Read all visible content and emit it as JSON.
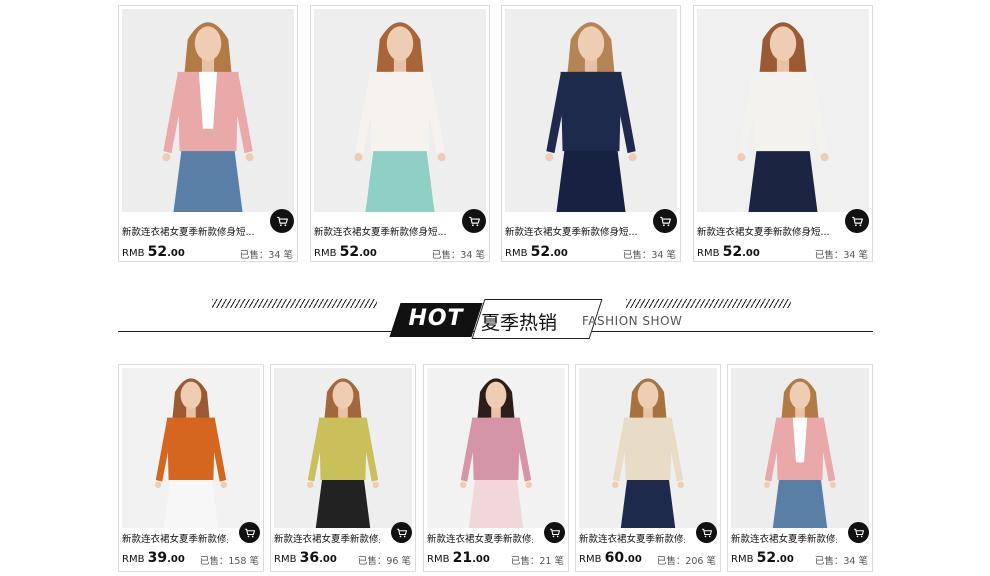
{
  "section": {
    "hot": "HOT",
    "title_cn": "夏季热销",
    "title_en": "FASHION SHOW"
  },
  "top_products": [
    {
      "title": "新款连衣裙女夏季新款修身短...",
      "currency": "RMB",
      "price_int": "52",
      "price_dec": ".00",
      "sold": "已售：34 笔",
      "colors": {
        "bg": "#ededed",
        "top": "#e8a9a8",
        "inner": "#ffffff",
        "bottom": "#5a7fa6",
        "hair": "#b27a45"
      }
    },
    {
      "title": "新款连衣裙女夏季新款修身短...",
      "currency": "RMB",
      "price_int": "52",
      "price_dec": ".00",
      "sold": "已售：34 笔",
      "colors": {
        "bg": "#eeeeee",
        "top": "#f6f3ee",
        "inner": "#f6f3ee",
        "bottom": "#8ecfc6",
        "hair": "#a8653a"
      }
    },
    {
      "title": "新款连衣裙女夏季新款修身短...",
      "currency": "RMB",
      "price_int": "52",
      "price_dec": ".00",
      "sold": "已售：34 笔",
      "colors": {
        "bg": "#eeeeee",
        "top": "#1d2a4c",
        "inner": "#1d2a4c",
        "bottom": "#172240",
        "hair": "#b58455"
      }
    },
    {
      "title": "新款连衣裙女夏季新款修身短...",
      "currency": "RMB",
      "price_int": "52",
      "price_dec": ".00",
      "sold": "已售：34 笔",
      "colors": {
        "bg": "#f0f0f0",
        "top": "#f4f2ef",
        "inner": "#f4f2ef",
        "bottom": "#1b2440",
        "hair": "#9a5a34"
      }
    }
  ],
  "bottom_products": [
    {
      "title": "新款连衣裙女夏季新款修身短...",
      "currency": "RMB",
      "price_int": "39",
      "price_dec": ".00",
      "sold": "已售：158 笔",
      "colors": {
        "bg": "#f2f2f2",
        "top": "#d4661f",
        "inner": "#d4661f",
        "bottom": "#f7f7f7",
        "hair": "#9a5a34"
      }
    },
    {
      "title": "新款连衣裙女夏季新款修身短...",
      "currency": "RMB",
      "price_int": "36",
      "price_dec": ".00",
      "sold": "已售：96 笔",
      "colors": {
        "bg": "#eeeeee",
        "top": "#c9c05a",
        "inner": "#c9c05a",
        "bottom": "#222222",
        "hair": "#a3663d"
      }
    },
    {
      "title": "新款连衣裙女夏季新款修身短...",
      "currency": "RMB",
      "price_int": "21",
      "price_dec": ".00",
      "sold": "已售：21 笔",
      "colors": {
        "bg": "#f2f2f2",
        "top": "#d595a8",
        "inner": "#d595a8",
        "bottom": "#f1d6da",
        "hair": "#2b1e18"
      }
    },
    {
      "title": "新款连衣裙女夏季新款修身短...",
      "currency": "RMB",
      "price_int": "60",
      "price_dec": ".00",
      "sold": "已售：206 笔",
      "colors": {
        "bg": "#efefef",
        "top": "#e8dcc6",
        "inner": "#e8dcc6",
        "bottom": "#1d2a4c",
        "hair": "#a8723f"
      }
    },
    {
      "title": "新款连衣裙女夏季新款修身短...",
      "currency": "RMB",
      "price_int": "52",
      "price_dec": ".00",
      "sold": "已售：34 笔",
      "colors": {
        "bg": "#ededed",
        "top": "#e8a9a8",
        "inner": "#ffffff",
        "bottom": "#5a7fa6",
        "hair": "#b27a45"
      }
    }
  ]
}
